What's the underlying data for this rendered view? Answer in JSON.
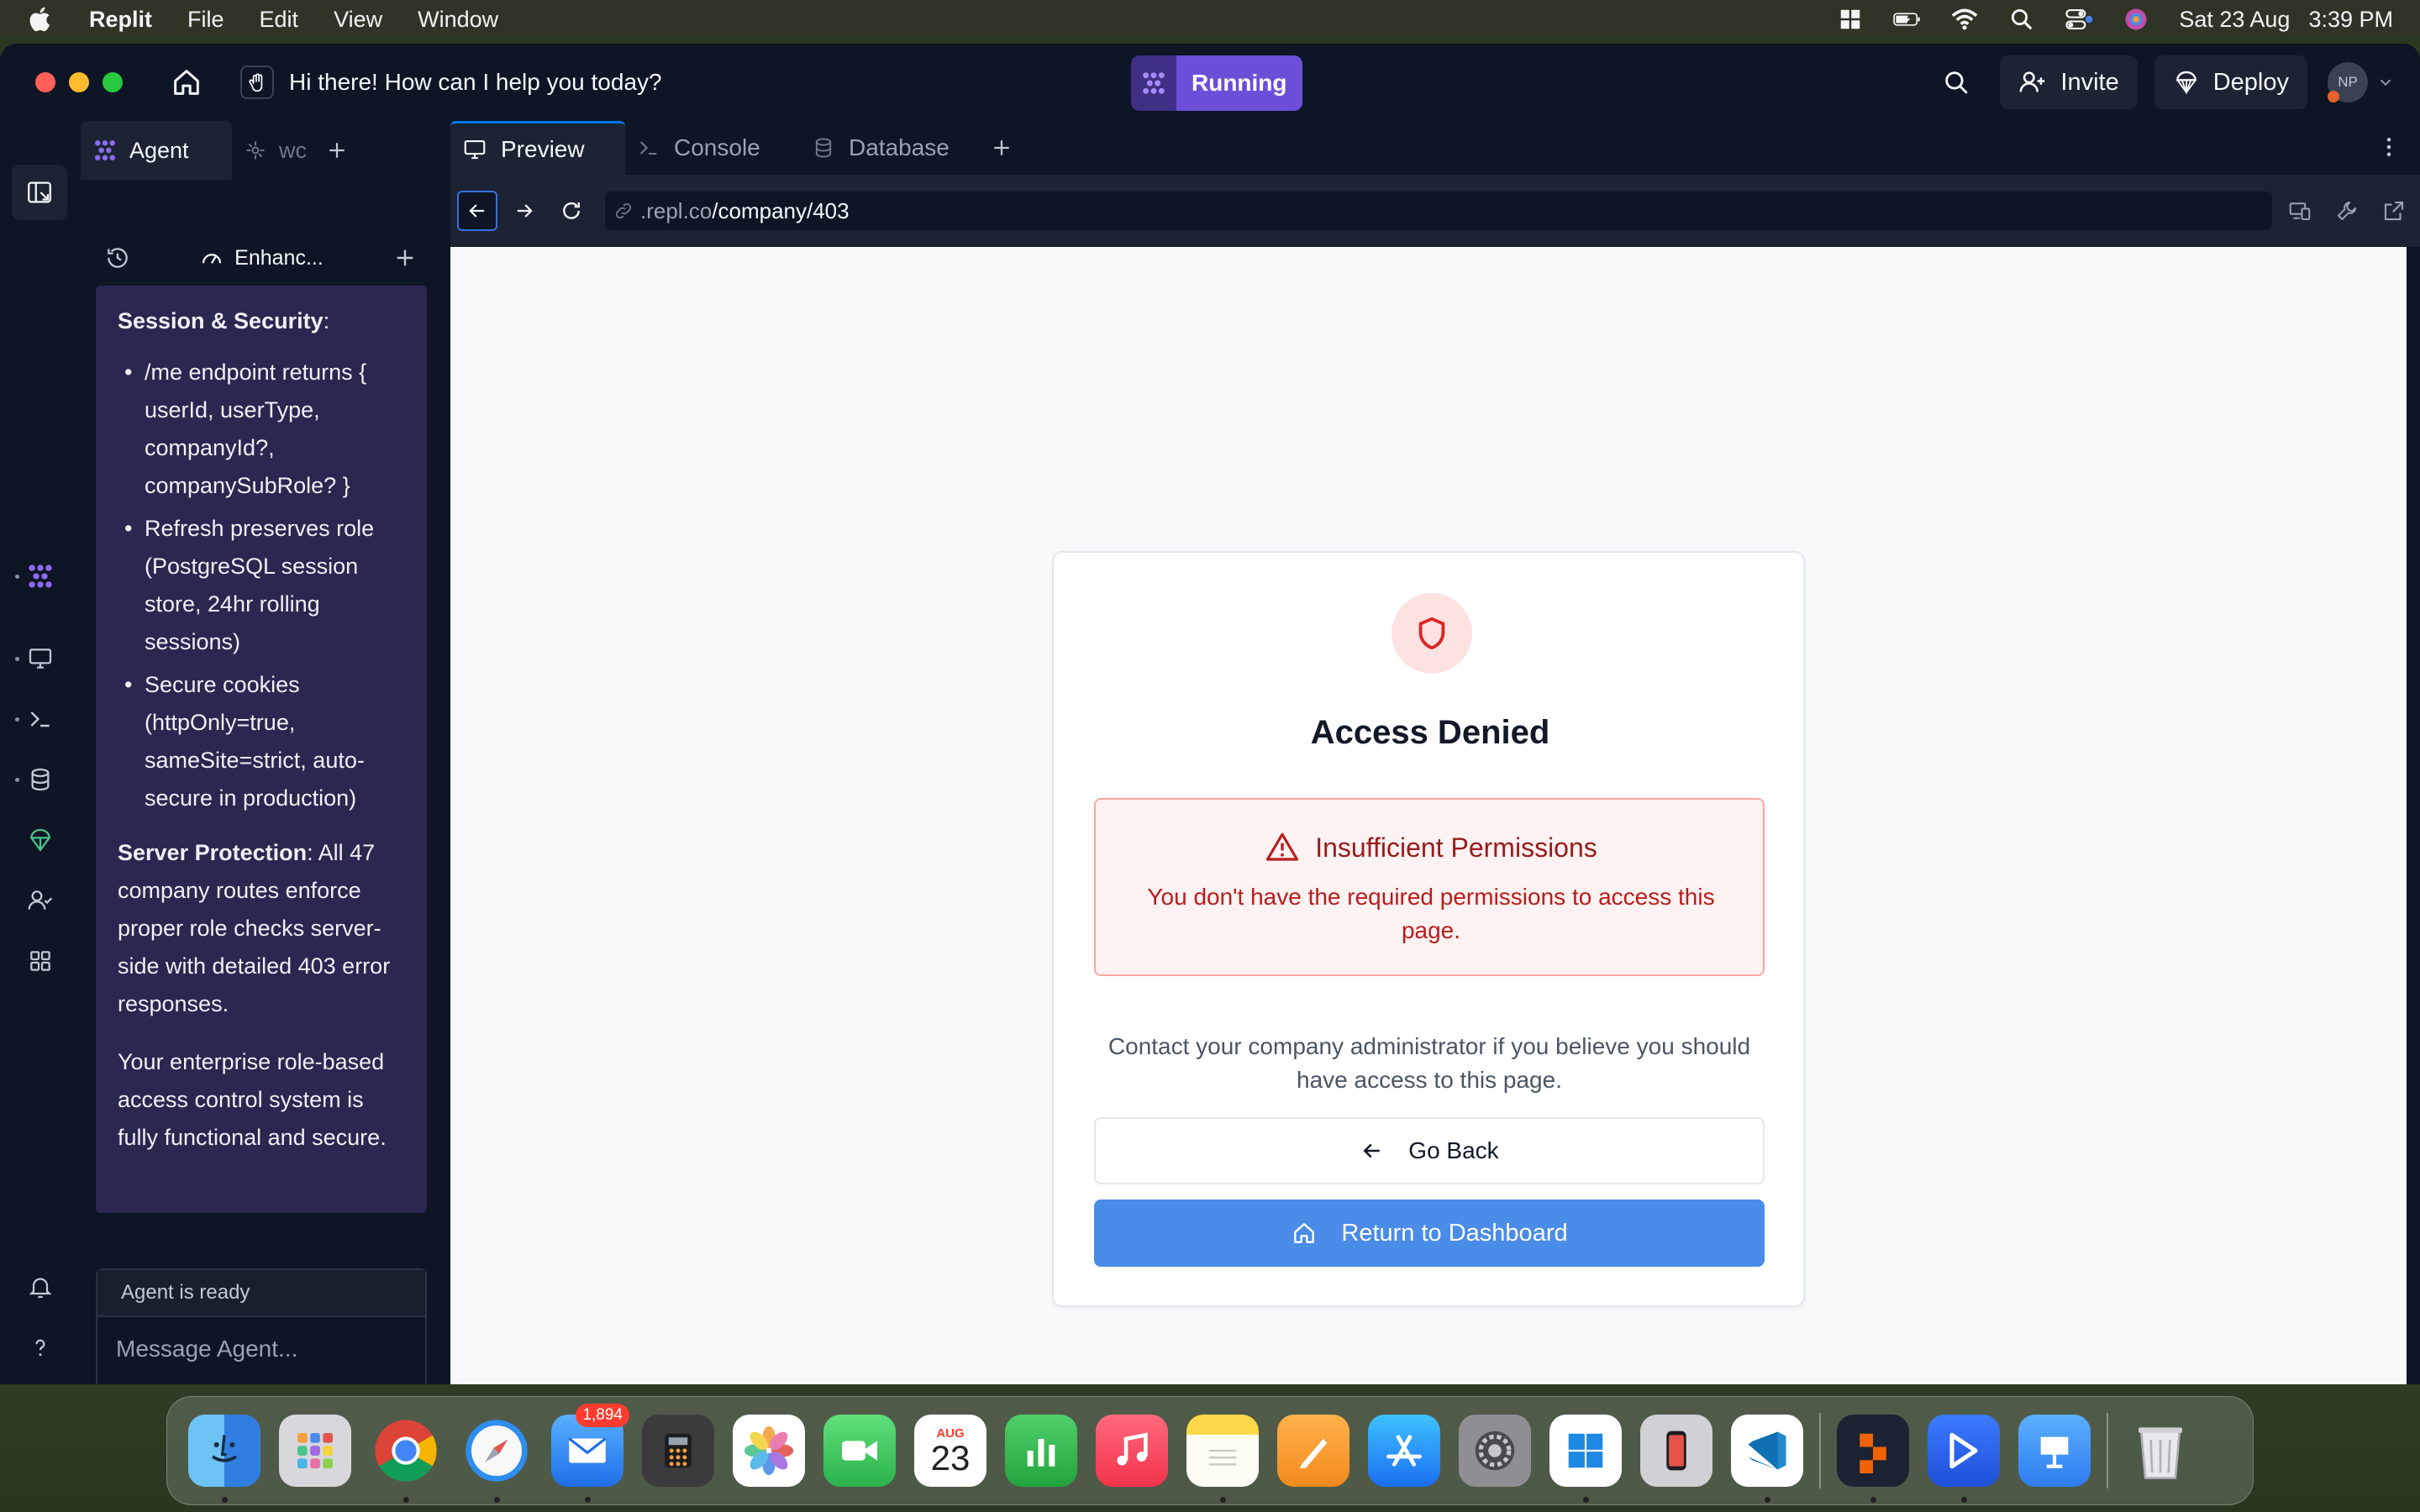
{
  "menubar": {
    "app_name": "Replit",
    "menus": [
      "File",
      "Edit",
      "View",
      "Window"
    ],
    "date": "Sat 23 Aug",
    "time": "3:39 PM"
  },
  "titlebar": {
    "prompt": "Hi there! How can I help you today?",
    "running_label": "Running",
    "invite_label": "Invite",
    "deploy_label": "Deploy",
    "avatar_initials": "NP"
  },
  "agent_panel": {
    "tab_agent": "Agent",
    "tab_second": "wc",
    "mode_label": "Enhanc...",
    "messages": {
      "session_heading": "Session & Security",
      "session_items": [
        "/me endpoint returns { userId, userType, companyId?, companySubRole? }",
        "Refresh preserves role (PostgreSQL session store, 24hr rolling sessions)",
        "Secure cookies (httpOnly=true, sameSite=strict, auto-secure in production)"
      ],
      "server_heading": "Server Protection",
      "server_text": ": All 47 company routes enforce proper role checks server-side with detailed 403 error responses.",
      "closing": "Your enterprise role-based access control system is fully functional and secure."
    },
    "status": "Agent is ready",
    "input_placeholder": "Message Agent..."
  },
  "main": {
    "tabs": [
      "Preview",
      "Console",
      "Database"
    ],
    "url_prefix": ".repl.co",
    "url_path": "/company/403"
  },
  "page": {
    "title": "Access Denied",
    "alert_title": "Insufficient Permissions",
    "alert_body": "You don't have the required permissions to access this page.",
    "contact": "Contact your company administrator if you believe you should have access to this page.",
    "back_label": "Go Back",
    "dashboard_label": "Return to Dashboard"
  },
  "dock": {
    "mail_badge": "1,894",
    "calendar_month": "AUG",
    "calendar_day": "23"
  },
  "colors": {
    "accent_running": "#6b4fd8",
    "danger": "#b91c1c",
    "primary_button": "#4a8ce8"
  }
}
